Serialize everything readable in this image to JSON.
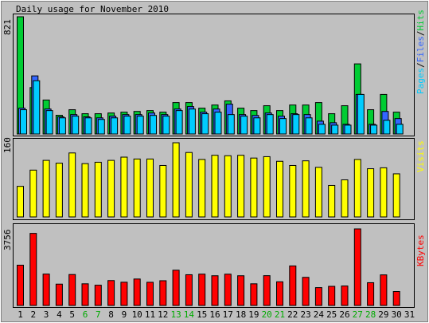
{
  "title": "Daily usage for November 2010",
  "colors": {
    "background": "#c0c0c0",
    "plot_bg": "#c0c0c0",
    "border": "#000000",
    "hits": "#00cc33",
    "files": "#3366ff",
    "pages": "#00ccff",
    "visits": "#ffff00",
    "kbytes": "#ff0000",
    "weekend_label": "#00aa00",
    "weekday_label": "#000000"
  },
  "chart_data": [
    {
      "type": "bar",
      "title": "",
      "ymax_label": "821",
      "ylim": [
        0,
        821
      ],
      "legend": [
        {
          "name": "Pages",
          "color": "#00ccff"
        },
        {
          "name": "Files",
          "color": "#3366ff"
        },
        {
          "name": "Hits",
          "color": "#00cc33"
        }
      ],
      "categories": [
        "1",
        "2",
        "3",
        "4",
        "5",
        "6",
        "7",
        "8",
        "9",
        "10",
        "11",
        "12",
        "13",
        "14",
        "15",
        "16",
        "17",
        "18",
        "19",
        "20",
        "21",
        "22",
        "23",
        "24",
        "25",
        "26",
        "27",
        "28",
        "29",
        "30",
        "31"
      ],
      "series": [
        {
          "name": "Hits",
          "values": [
            821,
            325,
            238,
            131,
            170,
            142,
            142,
            147,
            153,
            158,
            164,
            153,
            220,
            220,
            181,
            203,
            232,
            181,
            164,
            198,
            164,
            203,
            203,
            220,
            142,
            198,
            491,
            170,
            277,
            153,
            null
          ]
        },
        {
          "name": "Files",
          "values": [
            181,
            407,
            175,
            120,
            136,
            120,
            113,
            125,
            136,
            136,
            147,
            136,
            175,
            192,
            153,
            175,
            209,
            136,
            130,
            147,
            125,
            142,
            136,
            90,
            79,
            68,
            277,
            68,
            158,
            108,
            null
          ]
        },
        {
          "name": "Pages",
          "values": [
            170,
            373,
            164,
            113,
            125,
            113,
            102,
            113,
            125,
            125,
            130,
            125,
            164,
            175,
            142,
            153,
            136,
            125,
            113,
            136,
            108,
            136,
            113,
            68,
            62,
            62,
            277,
            62,
            96,
            68,
            null
          ]
        }
      ]
    },
    {
      "type": "bar",
      "title": "",
      "ymax_label": "160",
      "ylim": [
        0,
        160
      ],
      "legend": [
        {
          "name": "Visits",
          "color": "#ffff00"
        }
      ],
      "categories": [
        "1",
        "2",
        "3",
        "4",
        "5",
        "6",
        "7",
        "8",
        "9",
        "10",
        "11",
        "12",
        "13",
        "14",
        "15",
        "16",
        "17",
        "18",
        "19",
        "20",
        "21",
        "22",
        "23",
        "24",
        "25",
        "26",
        "27",
        "28",
        "29",
        "30",
        "31"
      ],
      "series": [
        {
          "name": "Visits",
          "values": [
            66,
            101,
            122,
            116,
            138,
            115,
            118,
            122,
            129,
            125,
            125,
            111,
            160,
            139,
            124,
            133,
            132,
            133,
            127,
            130,
            120,
            111,
            121,
            107,
            68,
            80,
            124,
            104,
            106,
            93,
            null
          ]
        }
      ]
    },
    {
      "type": "bar",
      "title": "",
      "ymax_label": "3756",
      "ylim": [
        0,
        3756
      ],
      "legend": [
        {
          "name": "KBytes",
          "color": "#ff0000"
        }
      ],
      "categories": [
        "1",
        "2",
        "3",
        "4",
        "5",
        "6",
        "7",
        "8",
        "9",
        "10",
        "11",
        "12",
        "13",
        "14",
        "15",
        "16",
        "17",
        "18",
        "19",
        "20",
        "21",
        "22",
        "23",
        "24",
        "25",
        "26",
        "27",
        "28",
        "29",
        "30",
        "31"
      ],
      "series": [
        {
          "name": "KBytes",
          "values": [
            1976,
            3536,
            1540,
            1047,
            1518,
            1063,
            995,
            1222,
            1140,
            1298,
            1137,
            1214,
            1730,
            1508,
            1537,
            1458,
            1535,
            1458,
            1063,
            1462,
            1161,
            1939,
            1379,
            876,
            938,
            955,
            3756,
            1117,
            1500,
            684,
            null
          ]
        }
      ]
    }
  ],
  "x_labels": {
    "days": [
      "1",
      "2",
      "3",
      "4",
      "5",
      "6",
      "7",
      "8",
      "9",
      "10",
      "11",
      "12",
      "13",
      "14",
      "15",
      "16",
      "17",
      "18",
      "19",
      "20",
      "21",
      "22",
      "23",
      "24",
      "25",
      "26",
      "27",
      "28",
      "29",
      "30",
      "31"
    ],
    "weekend": [
      false,
      false,
      false,
      false,
      false,
      true,
      true,
      false,
      false,
      false,
      false,
      false,
      true,
      true,
      false,
      false,
      false,
      false,
      false,
      true,
      true,
      false,
      false,
      false,
      false,
      false,
      true,
      true,
      false,
      false,
      false
    ]
  }
}
